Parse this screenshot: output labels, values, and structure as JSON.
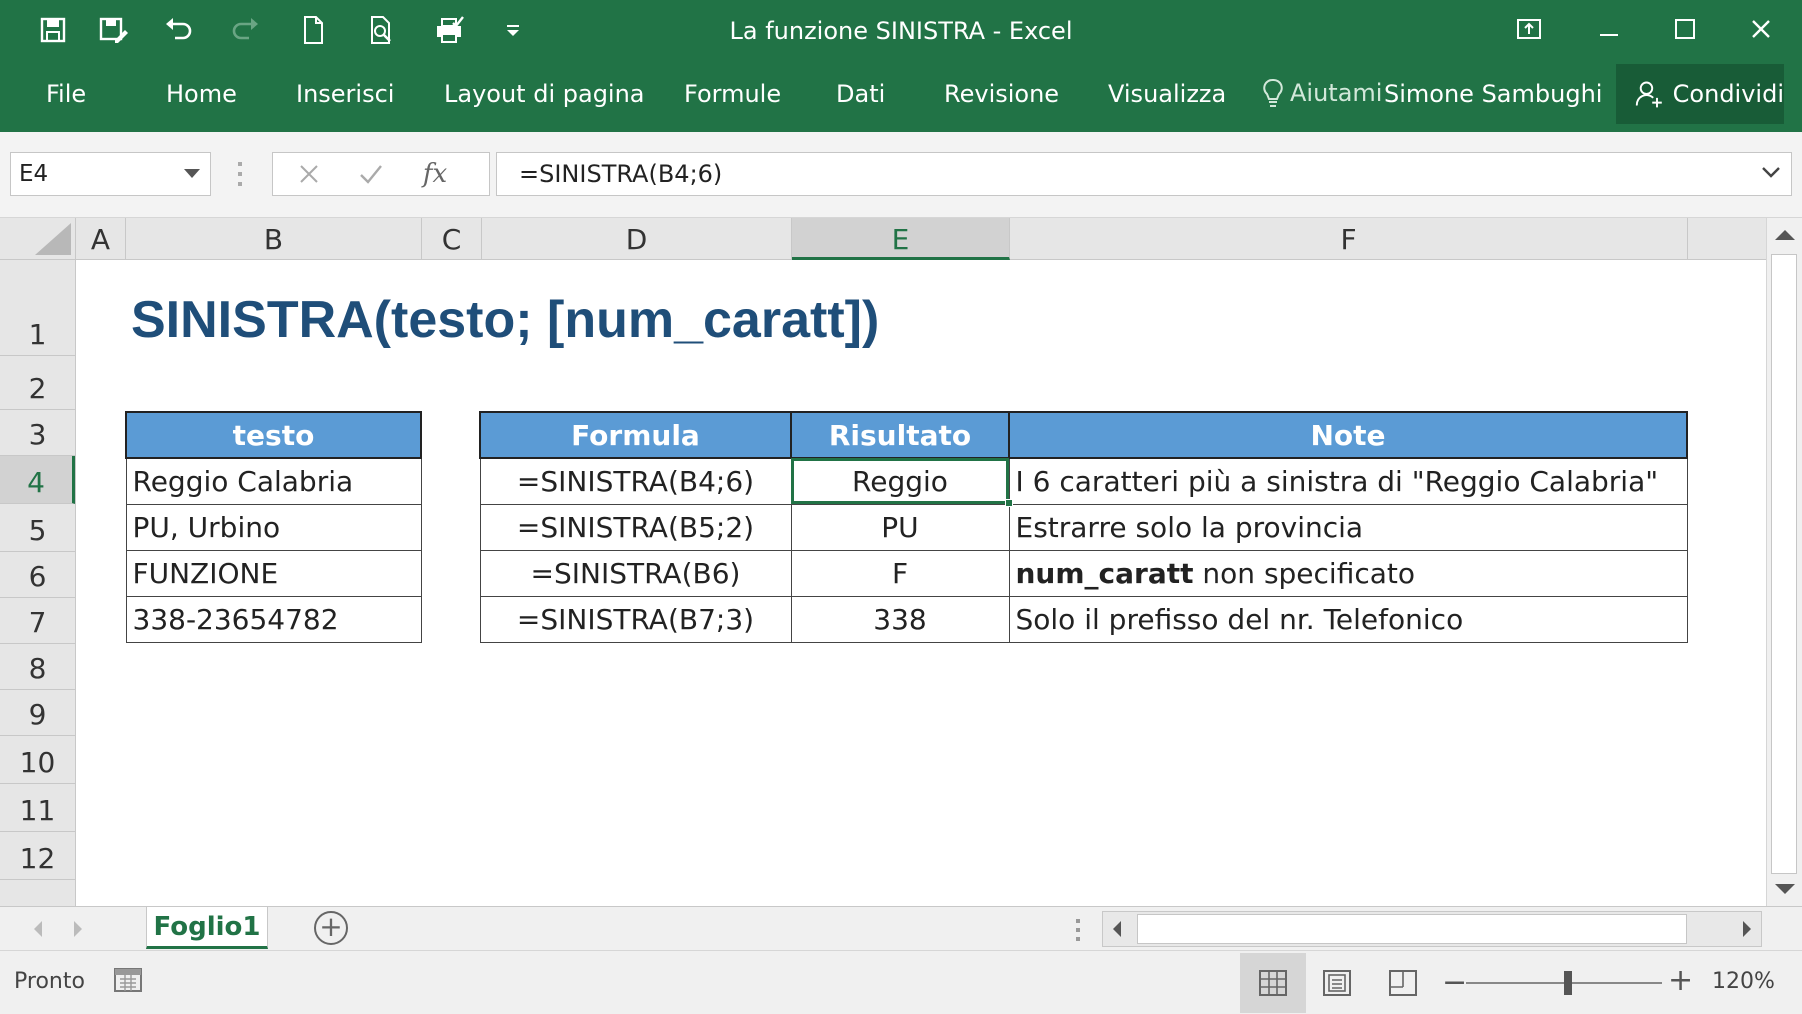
{
  "window": {
    "title": "La funzione SINISTRA - Excel",
    "accent_color": "#217346",
    "quick_access_icons": [
      "save-icon",
      "save-as-icon",
      "undo-icon",
      "redo-icon",
      "new-document-icon",
      "print-preview-icon",
      "quick-print-icon",
      "customize-qat-icon"
    ],
    "controls": [
      "restore-ribbon-icon",
      "minimize-icon",
      "maximize-icon",
      "close-icon"
    ]
  },
  "ribbon": {
    "tabs": [
      "File",
      "Home",
      "Inserisci",
      "Layout di pagina",
      "Formule",
      "Dati",
      "Revisione",
      "Visualizza"
    ],
    "help_label": "Aiutami",
    "user_name": "Simone Sambughi",
    "share_label": "Condividi"
  },
  "formula_bar": {
    "name_box": "E4",
    "fx_label": "fx",
    "formula": "=SINISTRA(B4;6)"
  },
  "grid": {
    "columns": [
      "A",
      "B",
      "C",
      "D",
      "E",
      "F",
      "("
    ],
    "rows": [
      "1",
      "2",
      "3",
      "4",
      "5",
      "6",
      "7",
      "8",
      "9",
      "10",
      "11",
      "12"
    ],
    "active_column": "E",
    "active_row": "4",
    "title": "SINISTRA(testo; [num_caratt])",
    "header_fill": "#5b9bd5",
    "title_color": "#1f4e79",
    "text_table": {
      "header": "testo",
      "values": [
        "Reggio Calabria",
        "PU, Urbino",
        "FUNZIONE",
        "338-23654782"
      ]
    },
    "formula_table": {
      "headers": {
        "formula": "Formula",
        "result": "Risultato",
        "note": "Note"
      },
      "rows": [
        {
          "formula": "=SINISTRA(B4;6)",
          "result": "Reggio",
          "note_bold": "",
          "note": "I 6 caratteri più a sinistra di \"Reggio Calabria\""
        },
        {
          "formula": "=SINISTRA(B5;2)",
          "result": "PU",
          "note_bold": "",
          "note": "Estrarre solo la provincia"
        },
        {
          "formula": "=SINISTRA(B6)",
          "result": "F",
          "note_bold": "num_caratt",
          "note": " non specificato"
        },
        {
          "formula": "=SINISTRA(B7;3)",
          "result": "338",
          "note_bold": "",
          "note": "Solo il prefisso del nr. Telefonico"
        }
      ]
    }
  },
  "sheets": {
    "tabs": [
      "Foglio1"
    ],
    "add_label": "+"
  },
  "status_bar": {
    "status": "Pronto",
    "zoom_minus": "−",
    "zoom_plus": "+",
    "zoom_level": "120%",
    "zoom_fraction": 0.52,
    "view_icons": [
      "normal-view-icon",
      "page-layout-view-icon",
      "page-break-view-icon"
    ]
  }
}
